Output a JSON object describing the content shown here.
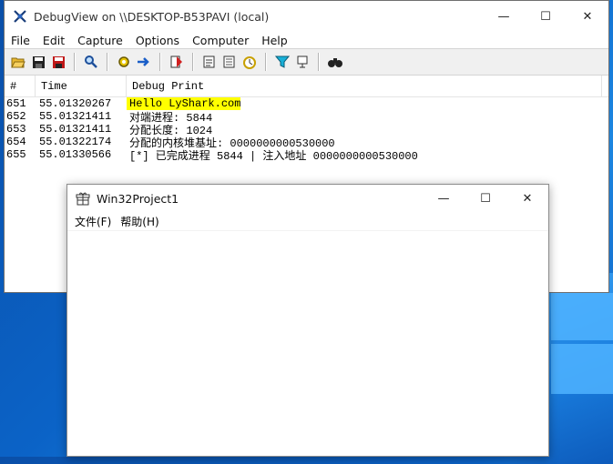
{
  "debugview": {
    "title": "DebugView on \\\\DESKTOP-B53PAVI (local)",
    "caption": {
      "minimize": "—",
      "maximize": "☐",
      "close": "✕"
    },
    "menu": [
      "File",
      "Edit",
      "Capture",
      "Options",
      "Computer",
      "Help"
    ],
    "columns": {
      "num": "#",
      "time": "Time",
      "debug": "Debug Print"
    },
    "rows": [
      {
        "num": "651",
        "time": "55.01320267",
        "msg": "Hello LyShark.com"
      },
      {
        "num": "652",
        "time": "55.01321411",
        "msg": "对端进程: 5844"
      },
      {
        "num": "653",
        "time": "55.01321411",
        "msg": "分配长度: 1024"
      },
      {
        "num": "654",
        "time": "55.01322174",
        "msg": "分配的内核堆基址: 0000000000530000"
      },
      {
        "num": "655",
        "time": "55.01330566",
        "msg": "[*] 已完成进程 5844 | 注入地址 0000000000530000"
      }
    ],
    "highlight_color": "#ffff00"
  },
  "win32": {
    "title": "Win32Project1",
    "caption": {
      "minimize": "—",
      "maximize": "☐",
      "close": "✕"
    },
    "menu": [
      "文件(F)",
      "帮助(H)"
    ]
  }
}
